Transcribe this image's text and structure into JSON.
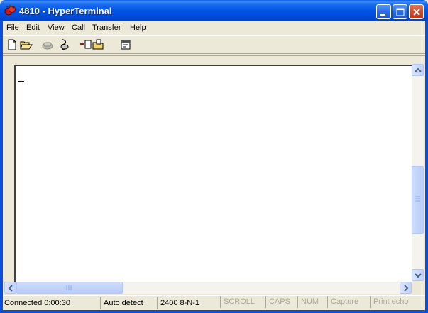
{
  "window": {
    "title": "4810 - HyperTerminal"
  },
  "menu": [
    "File",
    "Edit",
    "View",
    "Call",
    "Transfer",
    "Help"
  ],
  "toolbar": {
    "icons": [
      "new-connection-icon",
      "open-icon",
      "call-icon",
      "disconnect-icon",
      "send-file-icon",
      "receive-file-icon",
      "properties-icon"
    ]
  },
  "status": {
    "connected": "Connected 0:00:30",
    "detect": "Auto detect",
    "settings": "2400 8-N-1",
    "scroll": "SCROLL",
    "caps": "CAPS",
    "num": "NUM",
    "capture": "Capture",
    "print_echo": "Print echo"
  },
  "colors": {
    "titlebar": "#0055e5",
    "close": "#d2482b"
  }
}
